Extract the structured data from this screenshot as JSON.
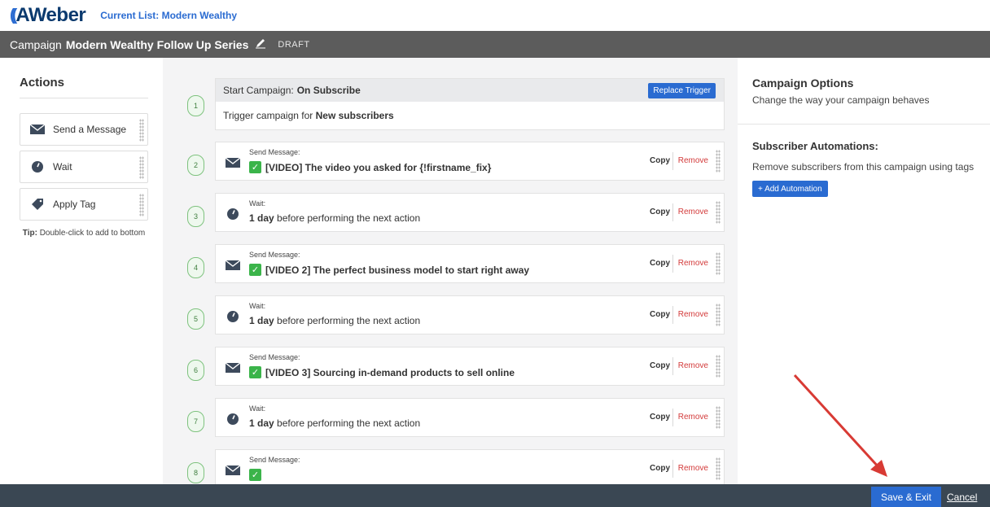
{
  "header": {
    "logo_text": "AWeber",
    "current_list_label": "Current List: Modern Wealthy"
  },
  "campaign_bar": {
    "prefix": "Campaign",
    "name": "Modern Wealthy Follow Up Series",
    "status": "DRAFT"
  },
  "actions": {
    "title": "Actions",
    "items": [
      {
        "label": "Send a Message",
        "icon": "envelope-icon"
      },
      {
        "label": "Wait",
        "icon": "clock-icon"
      },
      {
        "label": "Apply Tag",
        "icon": "tag-icon"
      }
    ],
    "tip_bold": "Tip:",
    "tip_text": " Double-click to add to bottom"
  },
  "trigger": {
    "number": "1",
    "head_prefix": "Start Campaign:",
    "head_value": "On Subscribe",
    "replace_label": "Replace Trigger",
    "body_prefix": "Trigger campaign for",
    "body_value": "New subscribers"
  },
  "steps": [
    {
      "number": "2",
      "type": "message",
      "label": "Send Message:",
      "text": "[VIDEO] The video you asked for {!firstname_fix}"
    },
    {
      "number": "3",
      "type": "wait",
      "label": "Wait:",
      "bold": "1 day",
      "text": " before performing the next action"
    },
    {
      "number": "4",
      "type": "message",
      "label": "Send Message:",
      "text": "[VIDEO 2] The perfect business model to start right away"
    },
    {
      "number": "5",
      "type": "wait",
      "label": "Wait:",
      "bold": "1 day",
      "text": " before performing the next action"
    },
    {
      "number": "6",
      "type": "message",
      "label": "Send Message:",
      "text": "[VIDEO 3] Sourcing in-demand products to sell online"
    },
    {
      "number": "7",
      "type": "wait",
      "label": "Wait:",
      "bold": "1 day",
      "text": " before performing the next action"
    },
    {
      "number": "8",
      "type": "message",
      "label": "Send Message:",
      "text": ""
    }
  ],
  "step_actions": {
    "copy": "Copy",
    "remove": "Remove"
  },
  "options": {
    "title": "Campaign Options",
    "subtitle": "Change the way your campaign behaves",
    "automations_title": "Subscriber Automations:",
    "automations_text": "Remove subscribers from this campaign using tags",
    "add_automation_label": "+ Add Automation"
  },
  "footer": {
    "save_label": "Save & Exit",
    "cancel_label": "Cancel"
  },
  "colors": {
    "accent": "#2a6bd1",
    "remove": "#d33b3b",
    "check": "#3bb44a",
    "footer": "#3a4753"
  }
}
